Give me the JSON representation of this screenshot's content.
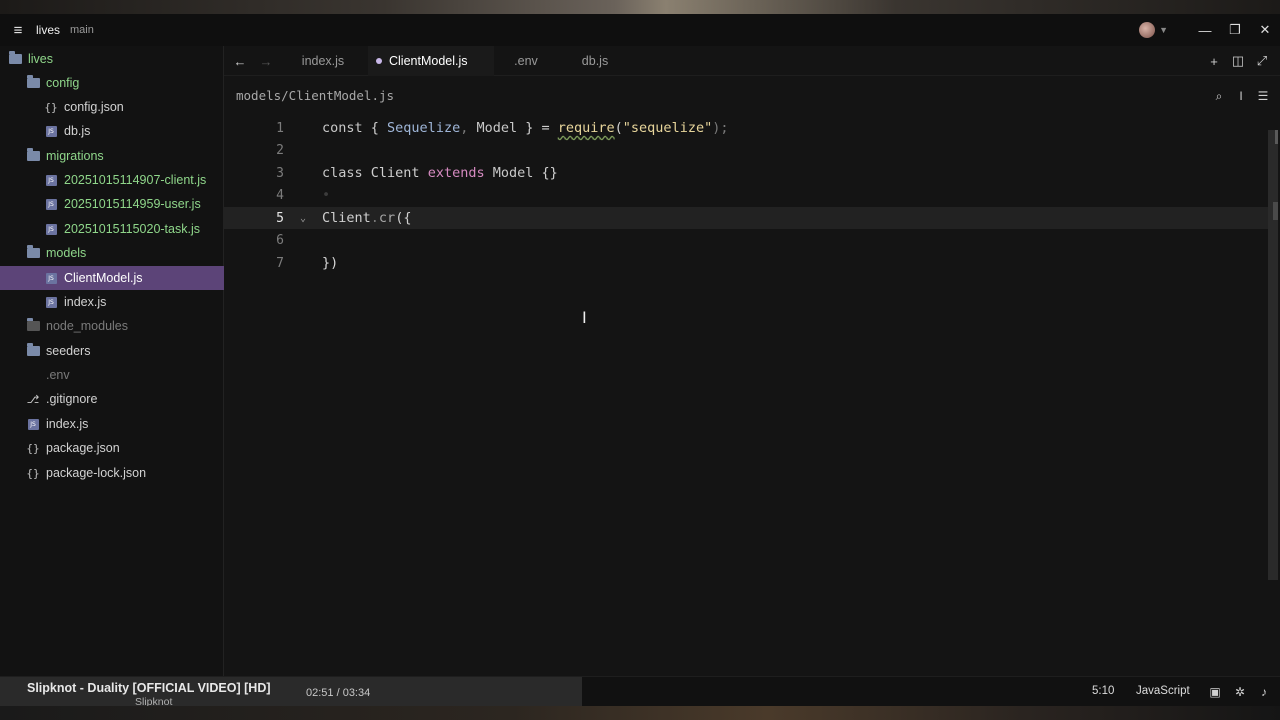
{
  "titlebar": {
    "project": "lives",
    "branch": "main",
    "menu_icon": "hamburger-icon"
  },
  "sidebar": {
    "items": [
      {
        "label": "lives",
        "type": "folder",
        "depth": 0
      },
      {
        "label": "config",
        "type": "folder",
        "depth": 1
      },
      {
        "label": "config.json",
        "type": "json",
        "depth": 2
      },
      {
        "label": "db.js",
        "type": "js",
        "depth": 2
      },
      {
        "label": "migrations",
        "type": "folder",
        "depth": 1
      },
      {
        "label": "20251015114907-client.js",
        "type": "js",
        "depth": 2
      },
      {
        "label": "20251015114959-user.js",
        "type": "js",
        "depth": 2
      },
      {
        "label": "20251015115020-task.js",
        "type": "js",
        "depth": 2
      },
      {
        "label": "models",
        "type": "folder",
        "depth": 1
      },
      {
        "label": "ClientModel.js",
        "type": "js",
        "depth": 2,
        "selected": true
      },
      {
        "label": "index.js",
        "type": "js",
        "depth": 2
      },
      {
        "label": "node_modules",
        "type": "folder",
        "depth": 1
      },
      {
        "label": "seeders",
        "type": "folder",
        "depth": 1
      },
      {
        "label": ".env",
        "type": "env",
        "depth": 1
      },
      {
        "label": ".gitignore",
        "type": "git",
        "depth": 1
      },
      {
        "label": "index.js",
        "type": "js",
        "depth": 1
      },
      {
        "label": "package.json",
        "type": "json",
        "depth": 1
      },
      {
        "label": "package-lock.json",
        "type": "json",
        "depth": 1
      }
    ]
  },
  "tabs": [
    {
      "label": "index.js",
      "active": false
    },
    {
      "label": "ClientModel.js",
      "active": true,
      "modified": true
    },
    {
      "label": ".env",
      "active": false
    },
    {
      "label": "db.js",
      "active": false
    }
  ],
  "breadcrumb": "models/ClientModel.js",
  "editor": {
    "line_numbers": [
      "1",
      "2",
      "3",
      "4",
      "5",
      "6",
      "7"
    ],
    "current_line": 5,
    "lines": {
      "l1": {
        "const": "const ",
        "ob": "{ ",
        "sequelize": "Sequelize",
        "comma": ", ",
        "model": "Model",
        "cb": " } = ",
        "require": "require",
        "op": "(",
        "str": "\"sequelize\"",
        "cp": ");"
      },
      "l3": {
        "class": "class ",
        "client": "Client",
        "extends": " extends ",
        "model": "Model",
        "body": " {}"
      },
      "l4": {
        "ghost": "•"
      },
      "l5": {
        "obj": "Client",
        "dot": ".",
        "meth": "cr",
        "rest": "({"
      },
      "l7": {
        "text": "})"
      }
    }
  },
  "statusbar": {
    "media_title": "Slipknot - Duality [OFFICIAL VIDEO] [HD]",
    "media_artist": "Slipknot",
    "media_time": "02:51 / 03:34",
    "cursor_position": "5:10",
    "language": "JavaScript"
  }
}
